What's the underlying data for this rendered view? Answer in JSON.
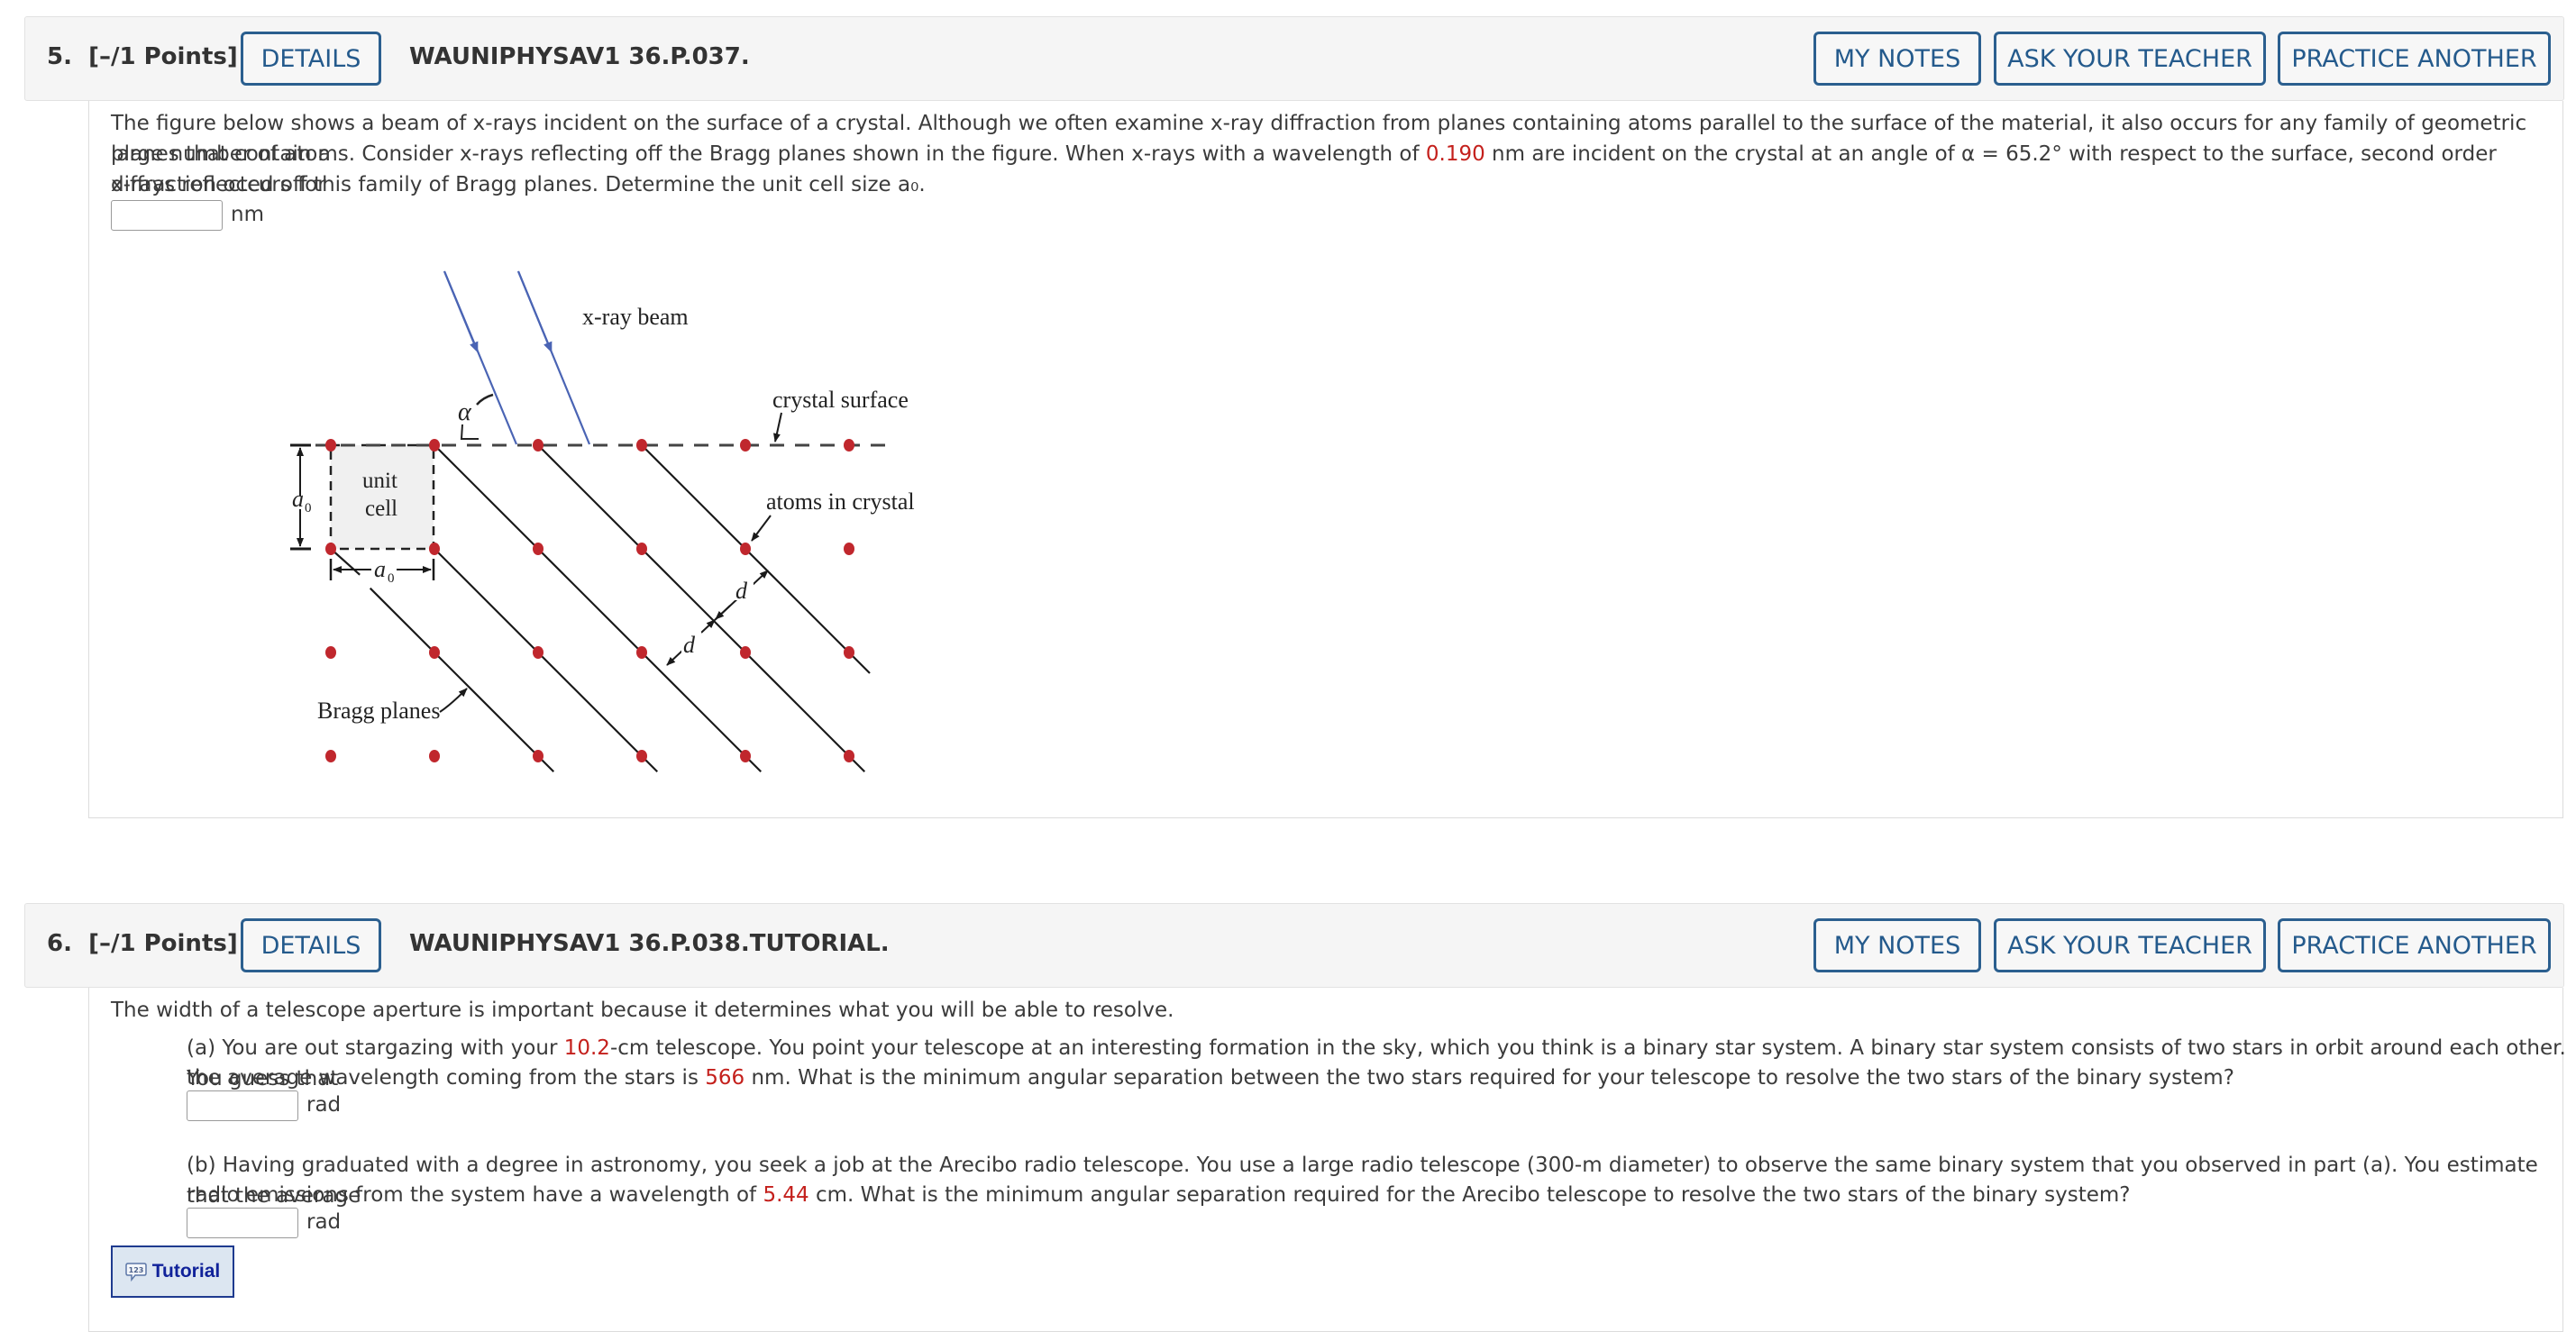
{
  "questions": [
    {
      "number_label": "5.",
      "points_label": "[–/1 Points]",
      "details_label": "DETAILS",
      "problem_id": "WAUNIPHYSAV1 36.P.037.",
      "my_notes_label": "MY NOTES",
      "ask_teacher_label": "ASK YOUR TEACHER",
      "practice_another_label": "PRACTICE ANOTHER",
      "text": {
        "l1": "The figure below shows a beam of x-rays incident on the surface of a crystal. Although we often examine x-ray diffraction from planes containing atoms parallel to the surface of the material, it also occurs for any family of geometric planes that contain a",
        "l2_a": "large number of atoms. Consider x-rays reflecting off the Bragg planes shown in the figure. When x-rays with a wavelength of ",
        "wavelength": "0.190",
        "l2_b": " nm are incident on the crystal at an angle of  α = 65.2°  with respect to the surface, second order diffraction occurs for",
        "l3": "x-rays reflected off this family of Bragg planes. Determine the unit cell size  a₀."
      },
      "answer": {
        "value": "",
        "unit": "nm"
      },
      "figure": {
        "labels": {
          "xray_beam": "x-ray beam",
          "crystal_surface": "crystal surface",
          "atoms_in_crystal": "atoms in crystal",
          "unit": "unit",
          "cell": "cell",
          "a0": "a",
          "a0_sub": "0",
          "alpha": "α",
          "d": "d",
          "bragg_planes": "Bragg planes"
        },
        "colors": {
          "atom": "#c0272d",
          "beam": "#4a64b4",
          "line": "#1a1a1a",
          "cell_fill": "#f0f0f0"
        }
      }
    },
    {
      "number_label": "6.",
      "points_label": "[–/1 Points]",
      "details_label": "DETAILS",
      "problem_id": "WAUNIPHYSAV1 36.P.038.TUTORIAL.",
      "my_notes_label": "MY NOTES",
      "ask_teacher_label": "ASK YOUR TEACHER",
      "practice_another_label": "PRACTICE ANOTHER",
      "intro": "The width of a telescope aperture is important because it determines what you will be able to resolve.",
      "part_a": {
        "l1_a": "(a) You are out stargazing with your ",
        "aperture": "10.2",
        "l1_b": "-cm telescope. You point your telescope at an interesting formation in the sky, which you think is a binary star system. A binary star system consists of two stars in orbit around each other. You guess that",
        "l2_a": "the average wavelength coming from the stars is ",
        "wavelength": "566",
        "l2_b": " nm. What is the minimum angular separation between the two stars required for your telescope to resolve the two stars of the binary system?",
        "answer": "",
        "unit": "rad"
      },
      "part_b": {
        "l1": "(b) Having graduated with a degree in astronomy, you seek a job at the Arecibo radio telescope. You use a large radio telescope (300-m diameter) to observe the same binary system that you observed in part (a). You estimate that the average",
        "l2_a": "radio emissions from the system have a wavelength of ",
        "wavelength": "5.44",
        "l2_b": " cm. What is the minimum angular separation required for the Arecibo telescope to resolve the two stars of the binary system?",
        "answer": "",
        "unit": "rad"
      },
      "tutorial_label": "Tutorial",
      "tutorial_icon": "123"
    }
  ]
}
